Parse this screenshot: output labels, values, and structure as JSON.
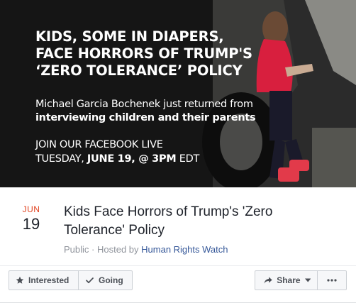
{
  "cover": {
    "headline": [
      "KIDS, SOME IN DIAPERS,",
      "FACE HORRORS OF TRUMP'S",
      "‘ZERO TOLERANCE’ POLICY"
    ],
    "subline": [
      "Michael Garcia Bochenek just returned from",
      "interviewing children and their parents"
    ],
    "cta": [
      "JOIN OUR FACEBOOK LIVE",
      "TUESDAY, JUNE 19, @ 3PM EDT"
    ],
    "cta_line2_light": "TUESDAY,",
    "cta_line2_bold": "JUNE 19, @ 3PM",
    "cta_line2_tail": "EDT"
  },
  "event": {
    "month": "JUN",
    "day": "19",
    "title": "Kids Face Horrors of Trump's 'Zero Tolerance' Policy",
    "visibility": "Public",
    "separator": " · ",
    "hosted_by_prefix": "Hosted by ",
    "host": "Human Rights Watch"
  },
  "actions": {
    "interested": "Interested",
    "going": "Going",
    "share": "Share",
    "more": "•••"
  },
  "colors": {
    "month": "#e0421f",
    "link": "#365899",
    "meta": "#90949c",
    "button_text": "#4b4f56"
  },
  "icons": {
    "interested": "star-icon",
    "going": "checkmark-icon",
    "share": "share-arrow-icon",
    "share_caret": "caret-down-icon",
    "more": "ellipsis-icon"
  }
}
